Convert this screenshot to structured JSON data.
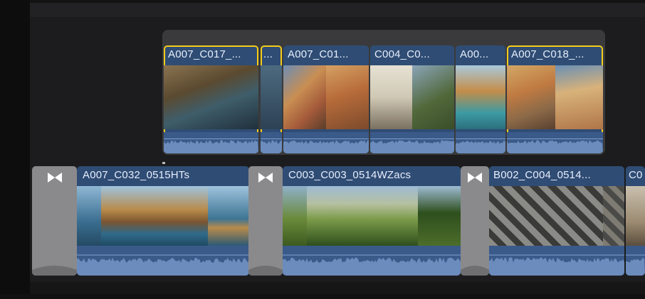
{
  "timeline": {
    "connected_storyline": {
      "clips": [
        {
          "label": "A007_C017_...",
          "selected": true,
          "thumb_colors": [
            "#6b5a3f",
            "#4c6b7a",
            "#243846"
          ]
        },
        {
          "label": "...",
          "selected": true,
          "thumb_colors": [
            "#3c586e"
          ]
        },
        {
          "label": "A007_C01...",
          "selected": false,
          "thumb_colors": [
            "#c98e52",
            "#6d8eb5"
          ]
        },
        {
          "label": "C004_C0...",
          "selected": false,
          "thumb_colors": [
            "#d9d9cf",
            "#51683a"
          ]
        },
        {
          "label": "A00...",
          "selected": false,
          "thumb_colors": [
            "#7fb2c8",
            "#c48d4a"
          ]
        },
        {
          "label": "A007_C018_...",
          "selected": true,
          "thumb_colors": [
            "#c79c58",
            "#8c6a48",
            "#6a8fb5"
          ]
        }
      ]
    },
    "primary_storyline": {
      "clips": [
        {
          "label": "A007_C032_0515HTs",
          "thumb_colors": [
            "#3a6d8f",
            "#a9773b",
            "#3d7593"
          ]
        },
        {
          "label": "C003_C003_0514WZacs",
          "thumb_colors": [
            "#4c6d2a",
            "#7c9c4a",
            "#2e4f1d"
          ]
        },
        {
          "label": "B002_C004_0514...",
          "thumb_colors": [
            "#8a8a86",
            "#4a4a48",
            "#7e7b72"
          ]
        },
        {
          "label": "C0",
          "thumb_colors": [
            "#9c8b72"
          ]
        }
      ],
      "transitions": [
        {
          "icon": "bowtie-transition-icon"
        },
        {
          "icon": "bowtie-transition-icon"
        },
        {
          "icon": "bowtie-transition-icon"
        }
      ]
    }
  },
  "colors": {
    "selection": "#f5cc1b",
    "clip_fill": "#2f4c74",
    "audio_fill": "#3a5a8a",
    "transition_fill": "#8a8a8c"
  }
}
